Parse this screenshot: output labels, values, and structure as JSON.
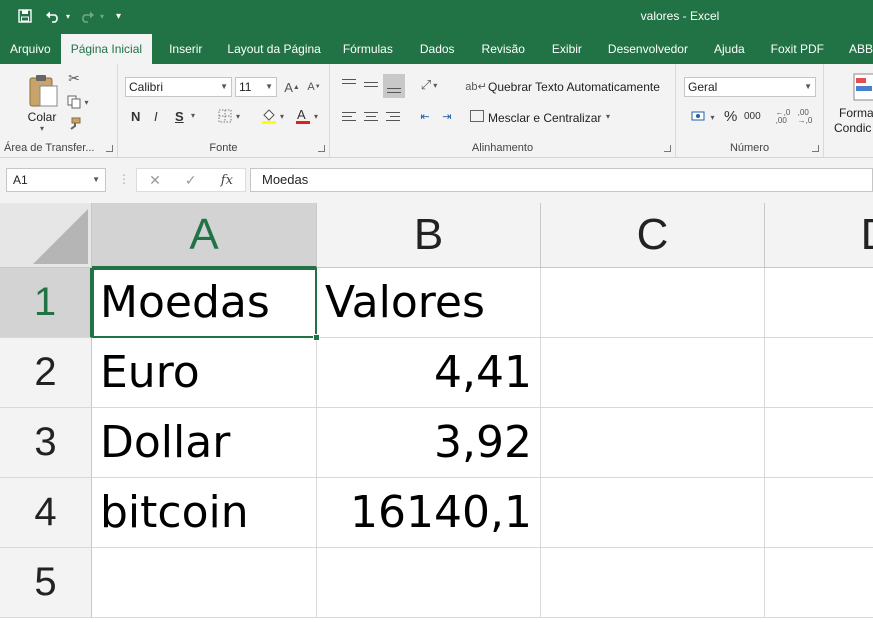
{
  "window": {
    "title": "valores  -  Excel"
  },
  "qat": {
    "save": "save-icon",
    "undo": "undo-icon",
    "redo": "redo-icon",
    "customize": "▾"
  },
  "tabs": [
    "Arquivo",
    "Página Inicial",
    "Inserir",
    "Layout da Página",
    "Fórmulas",
    "Dados",
    "Revisão",
    "Exibir",
    "Desenvolvedor",
    "Ajuda",
    "Foxit PDF",
    "ABBYY"
  ],
  "active_tab": "Página Inicial",
  "ribbon": {
    "clipboard": {
      "label": "Área de Transfer...",
      "paste_label": "Colar"
    },
    "font": {
      "label": "Fonte",
      "font_name": "Calibri",
      "font_size": "11",
      "bold": "N",
      "italic": "I",
      "underline": "S",
      "highlight_color": "#ffff00",
      "font_color": "#e02020"
    },
    "alignment": {
      "label": "Alinhamento",
      "wrap_text": "Quebrar Texto Automaticamente",
      "merge_center": "Mesclar e Centralizar"
    },
    "number": {
      "label": "Número",
      "format": "Geral",
      "percent": "%",
      "thousands": "000"
    },
    "styles": {
      "cond_format_line1": "Forma",
      "cond_format_line2": "Condic"
    }
  },
  "formula_bar": {
    "name_box": "A1",
    "value": "Moedas",
    "cancel": "✕",
    "enter": "✓",
    "fx": "fx"
  },
  "grid": {
    "columns": [
      "A",
      "B",
      "C",
      "D"
    ],
    "rows": [
      "1",
      "2",
      "3",
      "4",
      "5"
    ],
    "cells": [
      [
        "Moedas",
        "Valores"
      ],
      [
        "Euro",
        "4,41"
      ],
      [
        "Dollar",
        "3,92"
      ],
      [
        "bitcoin",
        "16140,1"
      ]
    ],
    "accent": "#217346"
  }
}
